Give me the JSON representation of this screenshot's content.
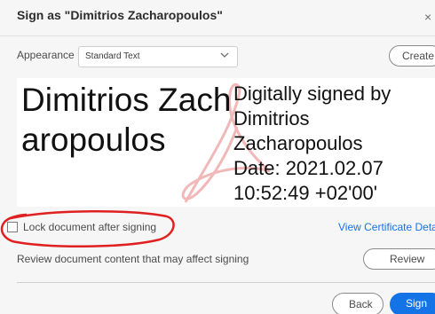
{
  "dialog": {
    "title": "Sign as \"Dimitrios Zacharopoulos\"",
    "close_glyph": "×"
  },
  "appearance": {
    "label": "Appearance",
    "selected": "Standard Text",
    "create_label": "Create"
  },
  "preview": {
    "name": "Dimitrios Zacharopoulos",
    "details_line1": "Digitally signed by",
    "details_line2": "Dimitrios",
    "details_line3": "Zacharopoulos",
    "details_line4": "Date: 2021.02.07",
    "details_line5": "10:52:49 +02'00'"
  },
  "options": {
    "lock_label": "Lock document after signing",
    "lock_checked": false,
    "view_certificate_label": "View Certificate Detai",
    "review_text": "Review document content that may affect signing",
    "review_label": "Review"
  },
  "footer": {
    "back_label": "Back",
    "sign_label": "Sign"
  },
  "colors": {
    "accent": "#1473e6",
    "annotation": "#e02020",
    "watermark": "#f2b8b8"
  }
}
